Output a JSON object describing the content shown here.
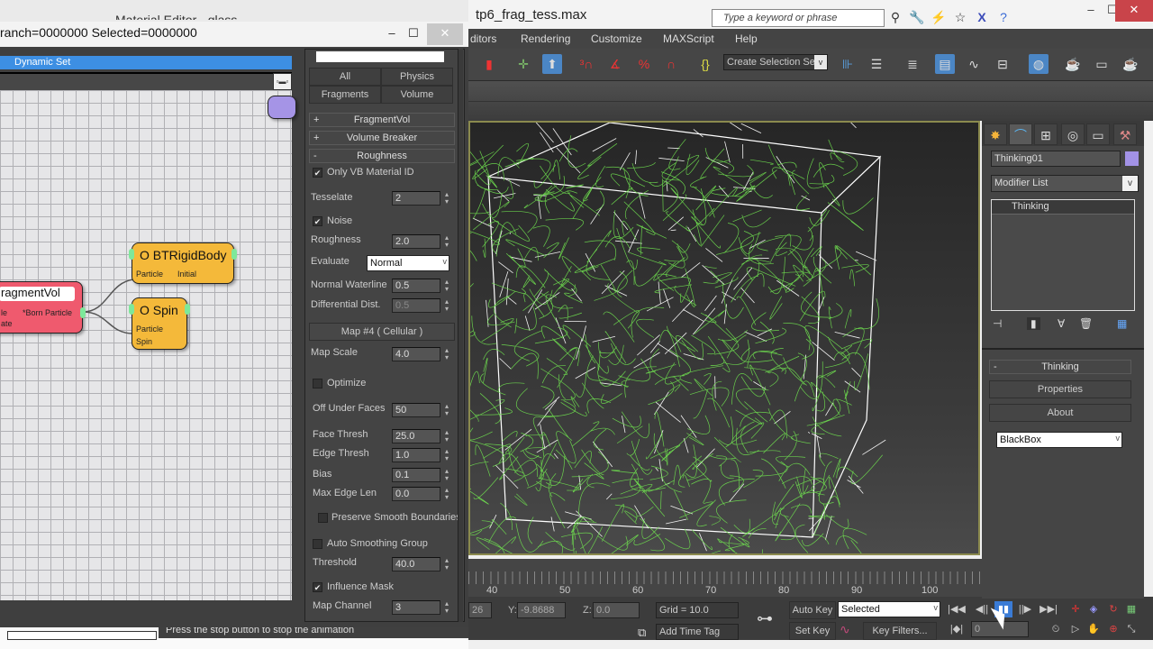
{
  "max_window": {
    "title": "tp6_frag_tess.max",
    "search_placeholder": "Type a keyword or phrase",
    "menu": [
      "ditors",
      "Rendering",
      "Customize",
      "MAXScript",
      "Help"
    ],
    "create_selection_set": "Create Selection Se",
    "toolbar_icons": [
      "select-and-link-icon",
      "move-icon",
      "select-object-icon",
      "snap-3d-icon",
      "angle-snap-icon",
      "percent-snap-icon",
      "spinner-snap-icon",
      "edit-named-sets-icon",
      "mirror-icon",
      "align-icon",
      "layer-manager-icon",
      "scene-explorer-icon",
      "curve-editor-icon",
      "schematic-view-icon",
      "material-editor-icon",
      "render-setup-icon",
      "rendered-frame-icon",
      "render-icon"
    ]
  },
  "material_editor": {
    "title": "Material Editor - glass"
  },
  "particle_flow": {
    "title": "ranch=0000000  Selected=0000000",
    "dynamic_set": "Dynamic Set",
    "filter_buttons": [
      "All",
      "Physics",
      "Fragments",
      "Volume"
    ],
    "nodes": {
      "fragmentvol": {
        "title": "ragmentVol",
        "ports": [
          "le",
          "*Born Particle",
          "ate"
        ],
        "color": "#ef5a6e"
      },
      "btrigidbody": {
        "title": "O BTRigidBody",
        "ports": [
          "Particle",
          "Initial"
        ],
        "color": "#f4b93a"
      },
      "spin": {
        "title": "O Spin",
        "ports": [
          "Particle",
          "Spin"
        ],
        "color": "#f4b93a"
      }
    },
    "rollouts": [
      {
        "sign": "+",
        "label": "FragmentVol"
      },
      {
        "sign": "+",
        "label": "Volume Breaker"
      },
      {
        "sign": "-",
        "label": "Roughness"
      }
    ],
    "params": {
      "only_vb_material_id": {
        "label": "Only VB Material ID",
        "checked": true
      },
      "tesselate": {
        "label": "Tesselate",
        "value": "2"
      },
      "noise": {
        "label": "Noise",
        "checked": true
      },
      "roughness": {
        "label": "Roughness",
        "value": "2.0"
      },
      "evaluate": {
        "label": "Evaluate",
        "value": "Normal"
      },
      "normal_waterline": {
        "label": "Normal Waterline",
        "value": "0.5"
      },
      "differential_dist": {
        "label": "Differential Dist.",
        "value": "0.5"
      },
      "map_button": "Map #4  ( Cellular )",
      "map_scale": {
        "label": "Map Scale",
        "value": "4.0"
      },
      "optimize": {
        "label": "Optimize",
        "checked": false
      },
      "off_under_faces": {
        "label": "Off Under Faces",
        "value": "50"
      },
      "face_thresh": {
        "label": "Face Thresh",
        "value": "25.0"
      },
      "edge_thresh": {
        "label": "Edge Thresh",
        "value": "1.0"
      },
      "bias": {
        "label": "Bias",
        "value": "0.1"
      },
      "max_edge_len": {
        "label": "Max Edge Len",
        "value": "0.0"
      },
      "preserve_smooth": {
        "label": "Preserve Smooth Boundaries",
        "checked": false
      },
      "auto_smoothing": {
        "label": "Auto Smoothing Group",
        "checked": false
      },
      "threshold": {
        "label": "Threshold",
        "value": "40.0"
      },
      "influence_mask": {
        "label": "Influence Mask",
        "checked": true
      },
      "map_channel": {
        "label": "Map Channel",
        "value": "3"
      }
    },
    "status_message": "Press the stop button to stop the animation"
  },
  "command_panel": {
    "object_name": "Thinking01",
    "object_color": "#a292e6",
    "modifier_list": "Modifier List",
    "stack": [
      "Thinking"
    ],
    "rollout_title": "Thinking",
    "buttons": [
      "Properties",
      "About"
    ],
    "dropdown": "BlackBox"
  },
  "timeline": {
    "ticks": [
      "40",
      "50",
      "60",
      "70",
      "80",
      "90",
      "100"
    ]
  },
  "status_bar": {
    "x_value": "26",
    "y_label": "Y:",
    "y_value": "-9.8688",
    "z_label": "Z:",
    "z_value": "0.0",
    "grid": "Grid = 10.0",
    "add_time_tag": "Add Time Tag",
    "auto_key": "Auto Key",
    "set_key": "Set Key",
    "key_mode": "Selected",
    "key_filters": "Key Filters...",
    "frame": "0"
  }
}
